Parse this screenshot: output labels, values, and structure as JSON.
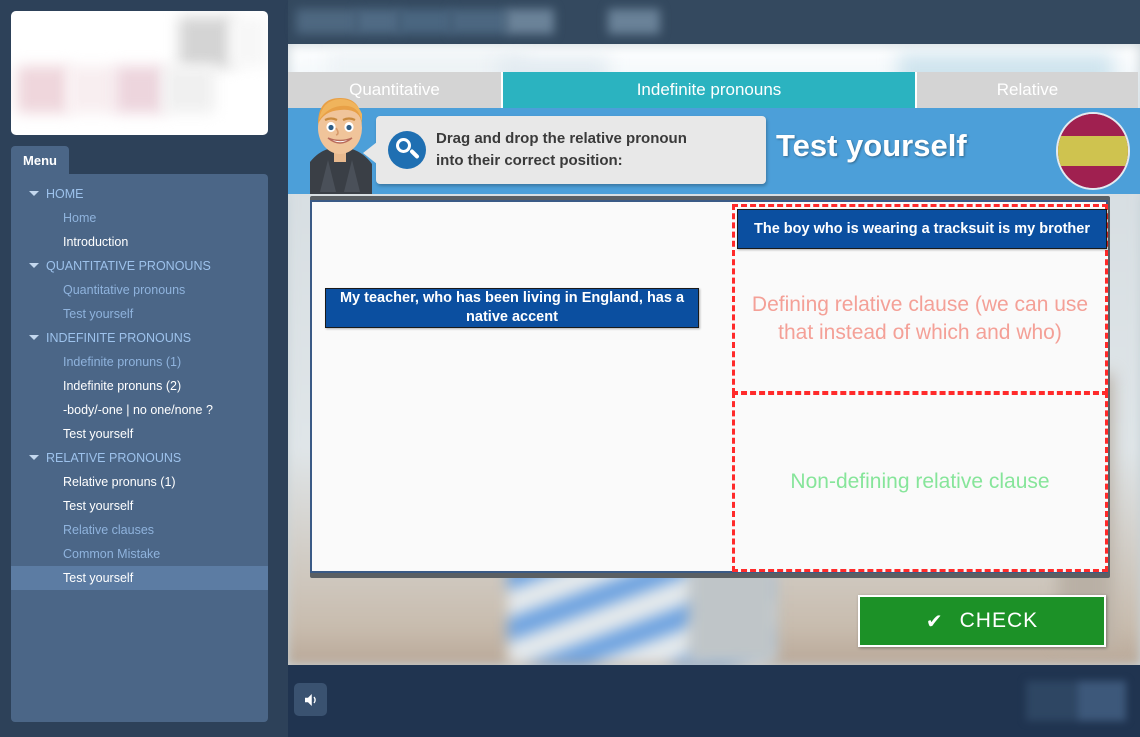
{
  "sidebar": {
    "menu_label": "Menu",
    "items": [
      {
        "label": "HOME",
        "type": "category"
      },
      {
        "label": "Home",
        "type": "sub",
        "state": "visited"
      },
      {
        "label": "Introduction",
        "type": "sub",
        "state": "normal"
      },
      {
        "label": "QUANTITATIVE PRONOUNS",
        "type": "category"
      },
      {
        "label": "Quantitative pronouns",
        "type": "sub",
        "state": "visited"
      },
      {
        "label": "Test yourself",
        "type": "sub",
        "state": "visited"
      },
      {
        "label": "INDEFINITE PRONOUNS",
        "type": "category"
      },
      {
        "label": "Indefinite pronuns (1)",
        "type": "sub",
        "state": "visited"
      },
      {
        "label": "Indefinite pronuns (2)",
        "type": "sub",
        "state": "normal"
      },
      {
        "label": "-body/-one | no one/none ?",
        "type": "sub",
        "state": "normal"
      },
      {
        "label": "Test yourself",
        "type": "sub",
        "state": "normal"
      },
      {
        "label": "RELATIVE PRONOUNS",
        "type": "category"
      },
      {
        "label": "Relative pronuns (1)",
        "type": "sub",
        "state": "normal"
      },
      {
        "label": "Test yourself",
        "type": "sub",
        "state": "normal"
      },
      {
        "label": "Relative clauses",
        "type": "sub",
        "state": "visited"
      },
      {
        "label": "Common Mistake",
        "type": "sub",
        "state": "visited"
      },
      {
        "label": "Test yourself",
        "type": "sub",
        "state": "active"
      }
    ]
  },
  "tabs": [
    {
      "label": "Quantitative",
      "active": false
    },
    {
      "label": "Indefinite pronouns",
      "active": true
    },
    {
      "label": "Relative",
      "active": false
    }
  ],
  "header": {
    "instruction_line1": "Drag and drop the relative pronoun",
    "instruction_line2": "into their correct position:",
    "title": "Test yourself",
    "flag": "spain-flag-icon",
    "magnifier_icon": "magnifier-icon",
    "avatar_icon": "teacher-avatar"
  },
  "exercise": {
    "tokens": [
      {
        "id": "teacher",
        "text": "My teacher, who has been living in England, has a native accent",
        "placed": false
      },
      {
        "id": "boy",
        "text": "The boy who is wearing a tracksuit is my brother",
        "placed": true,
        "zone": "defining"
      }
    ],
    "dropzones": [
      {
        "id": "defining",
        "label": "Defining relative clause (we can use that instead of which and who)",
        "color": "#f4a097"
      },
      {
        "id": "nondefining",
        "label": "Non-defining relative clause",
        "color": "#86e59a"
      }
    ]
  },
  "check_button": {
    "label": "CHECK",
    "icon": "check-mark-icon",
    "color": "#1c9127"
  },
  "bottom_bar": {
    "sound_icon": "speaker-icon"
  },
  "colors": {
    "sidebar_bg": "#4b6687",
    "page_bg": "#2d4159",
    "tab_active": "#2bb3c0",
    "tab_inactive": "#d4d4d4",
    "header_blue": "#4c9fd9",
    "token_blue": "#0b4fa0",
    "dropzone_border": "#ff2a2a"
  }
}
